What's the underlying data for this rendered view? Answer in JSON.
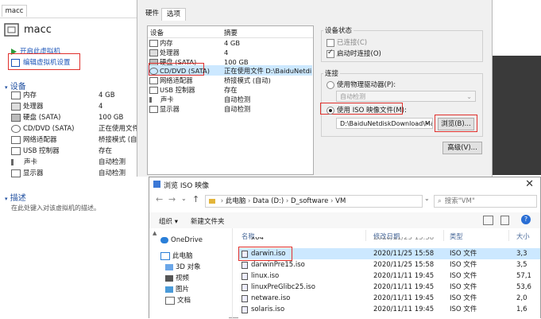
{
  "vm": {
    "name": "macc",
    "actions": [
      "开启此虚拟机",
      "编辑虚拟机设置"
    ],
    "devices_header": "设备",
    "devices": [
      {
        "name": "内存",
        "value": "4 GB",
        "icon": "memory-icon"
      },
      {
        "name": "处理器",
        "value": "4",
        "icon": "cpu-icon"
      },
      {
        "name": "硬盘 (SATA)",
        "value": "100 GB",
        "icon": "disk-icon"
      },
      {
        "name": "CD/DVD (SATA)",
        "value": "正在使用文件 D:\\",
        "icon": "cd-icon"
      },
      {
        "name": "网络适配器",
        "value": "桥接模式 (自",
        "icon": "network-icon"
      },
      {
        "name": "USB 控制器",
        "value": "存在",
        "icon": "usb-icon"
      },
      {
        "name": "声卡",
        "value": "自动检测",
        "icon": "sound-icon"
      },
      {
        "name": "显示器",
        "value": "自动检测",
        "icon": "display-icon"
      }
    ],
    "desc_header": "描述",
    "desc_text": "在此处键入对该虚拟机的描述。"
  },
  "settings": {
    "tabs": [
      "硬件",
      "选项"
    ],
    "columns": [
      "设备",
      "摘要"
    ],
    "rows": [
      {
        "name": "内存",
        "summary": "4 GB"
      },
      {
        "name": "处理器",
        "summary": "4"
      },
      {
        "name": "硬盘 (SATA)",
        "summary": "100 GB"
      },
      {
        "name": "CD/DVD (SATA)",
        "summary": "正在使用文件 D:\\BaiduNetdis..."
      },
      {
        "name": "网络适配器",
        "summary": "桥接模式 (自动)"
      },
      {
        "name": "USB 控制器",
        "summary": "存在"
      },
      {
        "name": "声卡",
        "summary": "自动检测"
      },
      {
        "name": "显示器",
        "summary": "自动检测"
      }
    ],
    "status_group": "设备状态",
    "connected": "已连接(C)",
    "connect_on_start": "启动时连接(O)",
    "connection_group": "连接",
    "physical": "使用物理驱动器(P):",
    "auto_detect": "自动检测",
    "use_iso": "使用 ISO 映像文件(M):",
    "iso_path": "D:\\BaiduNetdiskDownload\\Mac",
    "browse": "浏览(B)...",
    "advanced": "高级(V)..."
  },
  "browser": {
    "title": "浏览 ISO 映像",
    "breadcrumb": [
      "此电脑",
      "Data (D:)",
      "D_software",
      "VM"
    ],
    "search_placeholder": "搜索\"VM\"",
    "organize": "组织 ▾",
    "new_folder": "新建文件夹",
    "nav": [
      {
        "label": "OneDrive",
        "icon": "cloud-icon"
      },
      {
        "label": "此电脑",
        "icon": "computer-icon"
      },
      {
        "label": "3D 对象",
        "icon": "cube-icon"
      },
      {
        "label": "视频",
        "icon": "video-icon"
      },
      {
        "label": "图片",
        "icon": "picture-icon"
      },
      {
        "label": "文档",
        "icon": "document-icon"
      }
    ],
    "columns": [
      "名称",
      "修改日期",
      "类型",
      "大小"
    ],
    "top_partial": {
      "name": "x64",
      "date": "2020/11/25 15:58"
    },
    "files": [
      {
        "name": "darwin.iso",
        "date": "2020/11/25 15:58",
        "type": "ISO 文件",
        "size": "3,3"
      },
      {
        "name": "darwinPre15.iso",
        "date": "2020/11/25 15:58",
        "type": "ISO 文件",
        "size": "3,5"
      },
      {
        "name": "linux.iso",
        "date": "2020/11/11 19:45",
        "type": "ISO 文件",
        "size": "57,1"
      },
      {
        "name": "linuxPreGlibc25.iso",
        "date": "2020/11/11 19:45",
        "type": "ISO 文件",
        "size": "53,6"
      },
      {
        "name": "netware.iso",
        "date": "2020/11/11 19:45",
        "type": "ISO 文件",
        "size": "2,0"
      },
      {
        "name": "solaris.iso",
        "date": "2020/11/11 19:45",
        "type": "ISO 文件",
        "size": "1,6"
      }
    ],
    "colors": {
      "selected_row": "#cce8ff",
      "highlight": "#e0302c"
    }
  }
}
